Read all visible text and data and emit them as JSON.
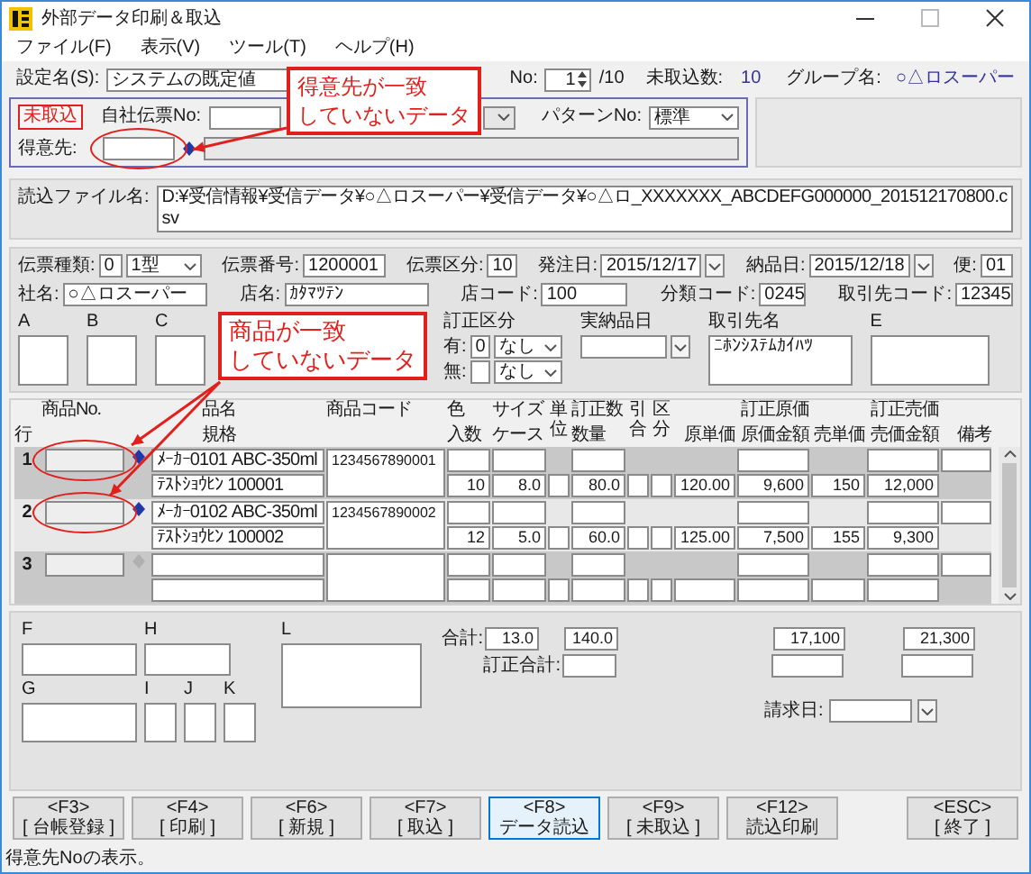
{
  "window": {
    "title": "外部データ印刷＆取込"
  },
  "menu": [
    {
      "label": "ファイル(F)"
    },
    {
      "label": "表示(V)"
    },
    {
      "label": "ツール(T)"
    },
    {
      "label": "ヘルプ(H)"
    }
  ],
  "header": {
    "setting_label": "設定名(S):",
    "setting": "システムの既定値",
    "slip_label": "No:",
    "slip_no": "1",
    "slip_total": "/10",
    "pending_label": "未取込数:",
    "pending": "10",
    "group_label": "グループ名:",
    "group": "○△ロスーパー"
  },
  "import": {
    "status": "未取込",
    "own_slip_label": "自社伝票No:",
    "pattern_label": "パターンNo:",
    "pattern": "標準",
    "customer_label": "得意先:",
    "customer_flagged": true
  },
  "file": {
    "label": "読込ファイル名:",
    "path": "D:¥受信情報¥受信データ¥○△ロスーパー¥受信データ¥○△ロ_XXXXXXX_ABCDEFG000000_201512170800.csv"
  },
  "slip": {
    "type_label": "伝票種類:",
    "type_code": "0",
    "type": "1型",
    "number_label": "伝票番号:",
    "number": "1200001",
    "class_label": "伝票区分:",
    "class": "10",
    "order_date_label": "発注日:",
    "order_date": "2015/12/17",
    "delivery_date_label": "納品日:",
    "delivery_date": "2015/12/18",
    "flight_label": "便:",
    "flight": "01",
    "company_label": "社名:",
    "company": "○△ロスーパー",
    "store_label": "店名:",
    "store": "ｶﾀﾏﾂﾃﾝ",
    "store_code_label": "店コード:",
    "store_code": "100",
    "category_label": "分類コード:",
    "category": "0245",
    "partner_code_label": "取引先コード:",
    "partner_code": "12345",
    "memo_a": "A",
    "memo_b": "B",
    "memo_c": "C",
    "correction_label": "訂正区分",
    "correction_yes_label": "有:",
    "correction_yes_code": "0",
    "correction_yes": "なし",
    "correction_no_label": "無:",
    "correction_no": "なし",
    "actual_date_label": "実納品日",
    "partner_name_label": "取引先名",
    "partner_name": "ﾆﾎﾝｼｽﾃﾑｶｲﾊﾂ",
    "memo_e": "E"
  },
  "table": {
    "columns": [
      {
        "bottom": "行"
      },
      {
        "top": "商品No."
      },
      {
        "top": "品名",
        "bottom": "規格"
      },
      {
        "top": "商品コード"
      },
      {
        "top": "色",
        "bottom": "入数"
      },
      {
        "top": "サイズ",
        "bottom": "ケース"
      },
      {
        "kind": "vertical",
        "text": "単位"
      },
      {
        "top": "訂正数",
        "bottom": "数量"
      },
      {
        "kind": "vertical",
        "text": "引合"
      },
      {
        "kind": "vertical",
        "text": "区分"
      },
      {
        "bottom": "原単価"
      },
      {
        "top": "訂正原価",
        "bottom": "原価金額"
      },
      {
        "bottom": "売単価"
      },
      {
        "top": "訂正売価",
        "bottom": "売価金額"
      },
      {
        "bottom": "備考"
      }
    ],
    "rows": [
      {
        "number": "1",
        "flagged": true,
        "lookup_enabled": true,
        "name": "ﾒｰｶｰ0101  ABC-350ml",
        "spec": "ﾃｽﾄｼｮｳﾋﾝ 100001",
        "code": "1234567890001",
        "quantity_per": "10",
        "cases": "8.0",
        "qty": "80.0",
        "unit_cost": "120.00",
        "cost_amount": "9,600",
        "unit_price": "150",
        "price_amount": "12,000"
      },
      {
        "number": "2",
        "flagged": true,
        "lookup_enabled": true,
        "name": "ﾒｰｶｰ0102  ABC-350ml",
        "spec": "ﾃｽﾄｼｮｳﾋﾝ 100002",
        "code": "1234567890002",
        "quantity_per": "12",
        "cases": "5.0",
        "qty": "60.0",
        "unit_cost": "125.00",
        "cost_amount": "7,500",
        "unit_price": "155",
        "price_amount": "9,300"
      },
      {
        "number": "3",
        "flagged": false,
        "lookup_enabled": false
      }
    ]
  },
  "totals": {
    "memo_f": "F",
    "memo_h": "H",
    "memo_l": "L",
    "memo_g": "G",
    "memo_i": "I",
    "memo_j": "J",
    "memo_k": "K",
    "total_label": "合計:",
    "total_cases": "13.0",
    "total_qty": "140.0",
    "total_cost": "17,100",
    "total_price": "21,300",
    "corrected_label": "訂正合計:",
    "billing_label": "請求日:"
  },
  "buttons": [
    {
      "key": "<F3>",
      "label": "[ 台帳登録 ]",
      "focused": false
    },
    {
      "key": "<F4>",
      "label": "[ 印刷 ]",
      "focused": false
    },
    {
      "key": "<F6>",
      "label": "[ 新規 ]",
      "focused": false
    },
    {
      "key": "<F7>",
      "label": "[ 取込 ]",
      "focused": false
    },
    {
      "key": "<F8>",
      "label": "データ読込",
      "focused": true
    },
    {
      "key": "<F9>",
      "label": "[ 未取込 ]",
      "focused": false
    },
    {
      "key": "<F12>",
      "label": "読込印刷",
      "focused": false
    },
    {
      "key": "<ESC>",
      "label": "[ 終了 ]",
      "focused": false
    }
  ],
  "status_bar": "得意先Noの表示。",
  "callouts": [
    {
      "lines": [
        "得意先が一致",
        "していないデータ"
      ]
    },
    {
      "lines": [
        "商品が一致",
        "していないデータ"
      ]
    }
  ]
}
